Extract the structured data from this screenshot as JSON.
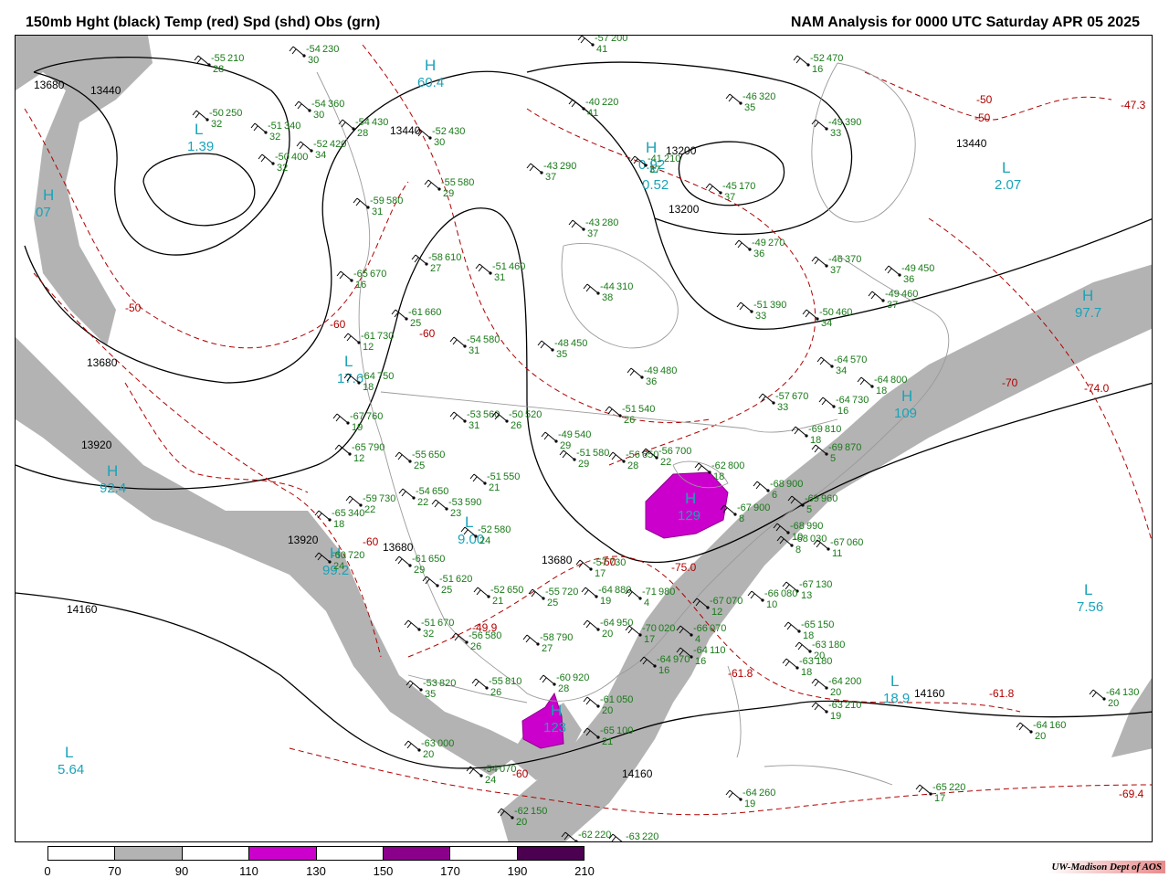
{
  "header": {
    "left_title": "150mb Hght (black) Temp (red) Spd (shd) Obs (grn)",
    "right_title": "NAM Analysis for 0000 UTC Saturday  APR 05 2025"
  },
  "colors": {
    "height_contour": "#000000",
    "temp_contour": "#b00000",
    "obs_text": "#1a7a1a",
    "center_label": "#1aa3b8",
    "shade_70_90": "#b3b3b3",
    "shade_110_130": "#cc00cc",
    "shade_150_170": "#8b008b",
    "shade_190_210": "#4b0050"
  },
  "legend": {
    "ticks": [
      "0",
      "70",
      "90",
      "110",
      "130",
      "150",
      "170",
      "190",
      "210"
    ],
    "bins": [
      {
        "from": "0",
        "to": "70",
        "color": "#ffffff"
      },
      {
        "from": "70",
        "to": "90",
        "color": "#b3b3b3"
      },
      {
        "from": "90",
        "to": "110",
        "color": "#ffffff"
      },
      {
        "from": "110",
        "to": "130",
        "color": "#cc00cc"
      },
      {
        "from": "130",
        "to": "150",
        "color": "#ffffff"
      },
      {
        "from": "150",
        "to": "170",
        "color": "#8b008b"
      },
      {
        "from": "170",
        "to": "190",
        "color": "#ffffff"
      },
      {
        "from": "190",
        "to": "210",
        "color": "#4b0050"
      }
    ]
  },
  "height_labels": [
    "13680",
    "13440",
    "13440",
    "13440",
    "13200",
    "13200",
    "13680",
    "13920",
    "13920",
    "13680",
    "13680",
    "14160",
    "14160",
    "14160"
  ],
  "temp_labels": [
    "-50",
    "-50",
    "-50",
    "-60",
    "-60",
    "-60",
    "-60",
    "-70",
    "-74.0",
    "-47.3",
    "-49.9",
    "-75.0",
    "-61.8",
    "-61.8",
    "-69.4",
    "-60"
  ],
  "centers": [
    {
      "letter": "L",
      "value": "1.39"
    },
    {
      "letter": "H",
      "value": "07"
    },
    {
      "letter": "H",
      "value": "60.4"
    },
    {
      "letter": "H",
      "value": "0.92"
    },
    {
      "letter": "L",
      "value": "0.52"
    },
    {
      "letter": "L",
      "value": "2.07"
    },
    {
      "letter": "H",
      "value": "97.7"
    },
    {
      "letter": "L",
      "value": "17.6"
    },
    {
      "letter": "H",
      "value": "92.4"
    },
    {
      "letter": "L",
      "value": "9.00"
    },
    {
      "letter": "H",
      "value": "99.2"
    },
    {
      "letter": "H",
      "value": "109"
    },
    {
      "letter": "L",
      "value": "7.56"
    },
    {
      "letter": "L",
      "value": "5.64"
    },
    {
      "letter": "L",
      "value": "18.9"
    },
    {
      "letter": "H",
      "value": "129"
    },
    {
      "letter": "H",
      "value": "123"
    }
  ],
  "observations": [
    {
      "t": "-54",
      "h": "230",
      "d": "30"
    },
    {
      "t": "-55",
      "h": "210",
      "d": "28"
    },
    {
      "t": "-50",
      "h": "250",
      "d": "32"
    },
    {
      "t": "-54",
      "h": "360",
      "d": "30"
    },
    {
      "t": "-51",
      "h": "340",
      "d": "32"
    },
    {
      "t": "-52",
      "h": "420",
      "d": "34"
    },
    {
      "t": "-50",
      "h": "400",
      "d": "32"
    },
    {
      "t": "-54",
      "h": "430",
      "d": "28"
    },
    {
      "t": "-52",
      "h": "430",
      "d": "30"
    },
    {
      "t": "-57",
      "h": "200",
      "d": "41"
    },
    {
      "t": "-40",
      "h": "220",
      "d": "41"
    },
    {
      "t": "-52",
      "h": "470",
      "d": "16"
    },
    {
      "t": "-46",
      "h": "320",
      "d": "35"
    },
    {
      "t": "-49",
      "h": "390",
      "d": "33"
    },
    {
      "t": "-43",
      "h": "290",
      "d": "37"
    },
    {
      "t": "-41",
      "h": "210",
      "d": "37"
    },
    {
      "t": "-45",
      "h": "170",
      "d": "37"
    },
    {
      "t": "-55",
      "h": "580",
      "d": "29"
    },
    {
      "t": "-59",
      "h": "580",
      "d": "31"
    },
    {
      "t": "-43",
      "h": "280",
      "d": "37"
    },
    {
      "t": "-49",
      "h": "270",
      "d": "36"
    },
    {
      "t": "-46",
      "h": "370",
      "d": "37"
    },
    {
      "t": "-49",
      "h": "450",
      "d": "36"
    },
    {
      "t": "-58",
      "h": "610",
      "d": "27"
    },
    {
      "t": "-51",
      "h": "460",
      "d": "31"
    },
    {
      "t": "-44",
      "h": "310",
      "d": "38"
    },
    {
      "t": "-49",
      "h": "460",
      "d": "37"
    },
    {
      "t": "-65",
      "h": "670",
      "d": "16"
    },
    {
      "t": "-61",
      "h": "660",
      "d": "25"
    },
    {
      "t": "-51",
      "h": "390",
      "d": "33"
    },
    {
      "t": "-50",
      "h": "460",
      "d": "34"
    },
    {
      "t": "-61",
      "h": "730",
      "d": "12"
    },
    {
      "t": "-54",
      "h": "580",
      "d": "31"
    },
    {
      "t": "-48",
      "h": "450",
      "d": "35"
    },
    {
      "t": "-49",
      "h": "480",
      "d": "36"
    },
    {
      "t": "-64",
      "h": "570",
      "d": "34"
    },
    {
      "t": "-64",
      "h": "750",
      "d": "18"
    },
    {
      "t": "-67",
      "h": "760",
      "d": "19"
    },
    {
      "t": "-53",
      "h": "560",
      "d": "31"
    },
    {
      "t": "-50",
      "h": "520",
      "d": "26"
    },
    {
      "t": "-51",
      "h": "540",
      "d": "26"
    },
    {
      "t": "-57",
      "h": "670",
      "d": "33"
    },
    {
      "t": "-64",
      "h": "730",
      "d": "16"
    },
    {
      "t": "-64",
      "h": "800",
      "d": "18"
    },
    {
      "t": "-65",
      "h": "790",
      "d": "12"
    },
    {
      "t": "-55",
      "h": "650",
      "d": "25"
    },
    {
      "t": "-49",
      "h": "540",
      "d": "29"
    },
    {
      "t": "-51",
      "h": "580",
      "d": "29"
    },
    {
      "t": "-56",
      "h": "650",
      "d": "28"
    },
    {
      "t": "-69",
      "h": "810",
      "d": "18"
    },
    {
      "t": "-69",
      "h": "870",
      "d": "5"
    },
    {
      "t": "-51",
      "h": "550",
      "d": "21"
    },
    {
      "t": "-59",
      "h": "730",
      "d": "22"
    },
    {
      "t": "-54",
      "h": "650",
      "d": "22"
    },
    {
      "t": "-53",
      "h": "590",
      "d": "23"
    },
    {
      "t": "-56",
      "h": "700",
      "d": "22"
    },
    {
      "t": "-62",
      "h": "800",
      "d": "18"
    },
    {
      "t": "-68",
      "h": "900",
      "d": "6"
    },
    {
      "t": "-65",
      "h": "340",
      "d": "18"
    },
    {
      "t": "-52",
      "h": "580",
      "d": "24"
    },
    {
      "t": "-67",
      "h": "900",
      "d": "8"
    },
    {
      "t": "-69",
      "h": "960",
      "d": "5"
    },
    {
      "t": "-60",
      "h": "720",
      "d": "24"
    },
    {
      "t": "-61",
      "h": "650",
      "d": "29"
    },
    {
      "t": "-57",
      "h": "730",
      "d": "17"
    },
    {
      "t": "-68",
      "h": "990",
      "d": "10"
    },
    {
      "t": "-68",
      "h": "030",
      "d": "8"
    },
    {
      "t": "-67",
      "h": "060",
      "d": "11"
    },
    {
      "t": "-51",
      "h": "620",
      "d": "25"
    },
    {
      "t": "-52",
      "h": "650",
      "d": "21"
    },
    {
      "t": "-55",
      "h": "720",
      "d": "25"
    },
    {
      "t": "-64",
      "h": "880",
      "d": "19"
    },
    {
      "t": "-71",
      "h": "980",
      "d": "4"
    },
    {
      "t": "-67",
      "h": "130",
      "d": "13"
    },
    {
      "t": "-51",
      "h": "670",
      "d": "32"
    },
    {
      "t": "-66",
      "h": "080",
      "d": "10"
    },
    {
      "t": "-67",
      "h": "070",
      "d": "12"
    },
    {
      "t": "-64",
      "h": "950",
      "d": "20"
    },
    {
      "t": "-70",
      "h": "020",
      "d": "17"
    },
    {
      "t": "-66",
      "h": "070",
      "d": "4"
    },
    {
      "t": "-58",
      "h": "790",
      "d": "27"
    },
    {
      "t": "-56",
      "h": "580",
      "d": "26"
    },
    {
      "t": "-64",
      "h": "970",
      "d": "16"
    },
    {
      "t": "-64",
      "h": "110",
      "d": "16"
    },
    {
      "t": "-65",
      "h": "150",
      "d": "18"
    },
    {
      "t": "-63",
      "h": "180",
      "d": "20"
    },
    {
      "t": "-63",
      "h": "180",
      "d": "18"
    },
    {
      "t": "-64",
      "h": "200",
      "d": "20"
    },
    {
      "t": "-63",
      "h": "210",
      "d": "19"
    },
    {
      "t": "-60",
      "h": "920",
      "d": "28"
    },
    {
      "t": "-53",
      "h": "820",
      "d": "35"
    },
    {
      "t": "-55",
      "h": "810",
      "d": "26"
    },
    {
      "t": "-61",
      "h": "050",
      "d": "20"
    },
    {
      "t": "-65",
      "h": "100",
      "d": "21"
    },
    {
      "t": "-63",
      "h": "000",
      "d": "20"
    },
    {
      "t": "-54",
      "h": "070",
      "d": "24"
    },
    {
      "t": "-64",
      "h": "130",
      "d": "20"
    },
    {
      "t": "-64",
      "h": "160",
      "d": "20"
    },
    {
      "t": "-65",
      "h": "220",
      "d": "17"
    },
    {
      "t": "-64",
      "h": "260",
      "d": "19"
    },
    {
      "t": "-62",
      "h": "150",
      "d": "20"
    },
    {
      "t": "-62",
      "h": "220",
      "d": "20"
    },
    {
      "t": "-63",
      "h": "220",
      "d": "20"
    }
  ],
  "credit": "UW-Madison   Dept of AOS"
}
